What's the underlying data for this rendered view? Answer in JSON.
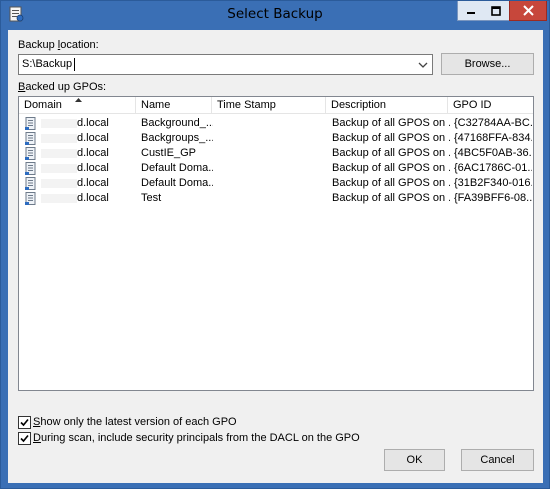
{
  "window": {
    "title": "Select Backup"
  },
  "backup_location": {
    "label_pre": "Backup ",
    "label_key": "l",
    "label_post": "ocation:",
    "value": "S:\\Backup",
    "browse_label": "Browse..."
  },
  "gpos": {
    "label_pre": "",
    "label_key": "B",
    "label_post": "acked up GPOs:",
    "columns": [
      "Domain",
      "Name",
      "Time Stamp",
      "Description",
      "GPO ID"
    ],
    "sort_column": "Domain",
    "rows": [
      {
        "domain": "d.local",
        "name": "Background_...",
        "timestamp": "",
        "description": "Backup of all GPOS on ...",
        "gpo_id": "{C32784AA-BC..."
      },
      {
        "domain": "d.local",
        "name": "Backgroups_...",
        "timestamp": "",
        "description": "Backup of all GPOS on ...",
        "gpo_id": "{47168FFA-834..."
      },
      {
        "domain": "d.local",
        "name": "CustIE_GP",
        "timestamp": "",
        "description": "Backup of all GPOS on ...",
        "gpo_id": "{4BC5F0AB-36..."
      },
      {
        "domain": "d.local",
        "name": "Default Doma...",
        "timestamp": "",
        "description": "Backup of all GPOS on ...",
        "gpo_id": "{6AC1786C-01..."
      },
      {
        "domain": "d.local",
        "name": "Default Doma...",
        "timestamp": "",
        "description": "Backup of all GPOS on ...",
        "gpo_id": "{31B2F340-016..."
      },
      {
        "domain": "d.local",
        "name": "Test",
        "timestamp": "",
        "description": "Backup of all GPOS on ...",
        "gpo_id": "{FA39BFF6-08..."
      }
    ]
  },
  "options": {
    "latest_only": {
      "label_pre": "",
      "label_key": "S",
      "label_post": "how only the latest version of each GPO",
      "checked": true
    },
    "include_dacl": {
      "label_pre": "",
      "label_key": "D",
      "label_post": "uring scan, include security principals from the DACL on the GPO",
      "checked": true
    }
  },
  "buttons": {
    "ok": "OK",
    "cancel": "Cancel"
  },
  "icons": {
    "app": "gpmc-icon",
    "row": "gpo-backup-icon",
    "combo": "chevron-down-icon",
    "sort": "sort-ascending-icon"
  }
}
